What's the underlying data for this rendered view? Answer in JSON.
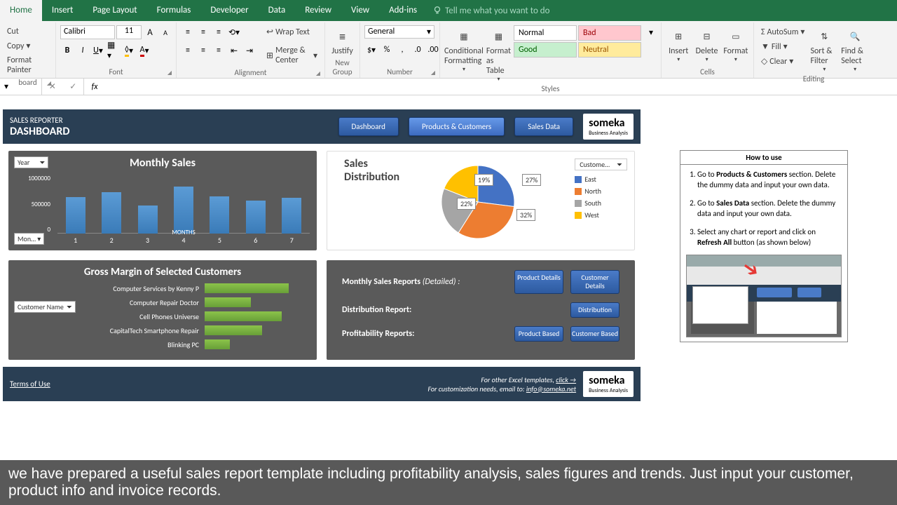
{
  "ribbon": {
    "tabs": [
      "Home",
      "Insert",
      "Page Layout",
      "Formulas",
      "Developer",
      "Data",
      "Review",
      "View",
      "Add-ins"
    ],
    "tellme": "Tell me what you want to do",
    "clipboard": {
      "cut": "Cut",
      "copy": "Copy",
      "painter": "Format Painter",
      "label": "board"
    },
    "font": {
      "name": "Calibri",
      "size": "11",
      "label": "Font"
    },
    "align": {
      "wrap": "Wrap Text",
      "merge": "Merge & Center",
      "label": "Alignment"
    },
    "newgroup": {
      "justify": "Justify",
      "label": "New Group"
    },
    "number": {
      "format": "General",
      "label": "Number"
    },
    "cond": "Conditional Formatting",
    "table": "Format as Table",
    "styles": {
      "normal": "Normal",
      "bad": "Bad",
      "good": "Good",
      "neutral": "Neutral",
      "label": "Styles"
    },
    "cells": {
      "insert": "Insert",
      "delete": "Delete",
      "format": "Format",
      "label": "Cells"
    },
    "editing": {
      "autosum": "AutoSum",
      "fill": "Fill",
      "clear": "Clear",
      "sort": "Sort & Filter",
      "find": "Find & Select",
      "label": "Editing"
    }
  },
  "dashboard": {
    "app": "SALES REPORTER",
    "title": "DASHBOARD",
    "nav": {
      "dashboard": "Dashboard",
      "products": "Products & Customers",
      "sales": "Sales Data"
    },
    "logo": "someka",
    "logosub": "Business Analysis",
    "monthly": {
      "title": "Monthly Sales",
      "yfilter": "Year",
      "mfilter": "Mon…",
      "xlabel": "MONTHS"
    },
    "pie": {
      "title1": "Sales",
      "title2": "Distribution",
      "legend_hdr": "Custome…"
    },
    "gm": {
      "title": "Gross Margin of Selected Customers",
      "filter": "Customer Name"
    },
    "reports": {
      "monthly": "Monthly Sales Reports",
      "monthly_det": "(Detailed) :",
      "dist": "Distribution Report:",
      "prof": "Profitability Reports:",
      "btn_pd": "Product Details",
      "btn_cd": "Customer Details",
      "btn_dist": "Distribution",
      "btn_pb": "Product Based",
      "btn_cb": "Customer Based"
    },
    "footer": {
      "terms": "Terms of Use",
      "other": "For other Excel templates,",
      "click": "click →",
      "custom": "For customization needs, email to:",
      "email": "info@someka.net"
    }
  },
  "howto": {
    "title": "How to use",
    "s1a": "Go to ",
    "s1b": "Products & Customers",
    "s1c": " section. Delete the dummy data and input your own data.",
    "s2a": "Go to ",
    "s2b": "Sales Data",
    "s2c": " section. Delete the dummy data and input your own data.",
    "s3a": "Select any chart or report and click on ",
    "s3b": "Refresh All",
    "s3c": " button (as shown below)"
  },
  "caption": "we have prepared a useful sales report template including profitability analysis, sales figures and trends. Just input your customer, product info and invoice records.",
  "chart_data": [
    {
      "type": "bar",
      "title": "Monthly Sales",
      "xlabel": "MONTHS",
      "ylabel": "",
      "ylim": [
        0,
        1000000
      ],
      "yticks": [
        0,
        500000,
        1000000
      ],
      "categories": [
        "1",
        "2",
        "3",
        "4",
        "5",
        "6",
        "7"
      ],
      "values": [
        620000,
        700000,
        480000,
        800000,
        630000,
        560000,
        610000
      ]
    },
    {
      "type": "pie",
      "title": "Sales Distribution",
      "series": [
        {
          "name": "East",
          "value": 27,
          "color": "#4472c4"
        },
        {
          "name": "North",
          "value": 32,
          "color": "#ed7d31"
        },
        {
          "name": "South",
          "value": 22,
          "color": "#a5a5a5"
        },
        {
          "name": "West",
          "value": 19,
          "color": "#ffc000"
        }
      ]
    },
    {
      "type": "bar",
      "orientation": "horizontal",
      "title": "Gross Margin of Selected Customers",
      "categories": [
        "Computer Services by Kenny P",
        "Computer Repair Doctor",
        "Cell Phones Universe",
        "CapitalTech Smartphone Repair",
        "Blinking PC"
      ],
      "values": [
        100,
        55,
        92,
        68,
        30
      ]
    }
  ]
}
